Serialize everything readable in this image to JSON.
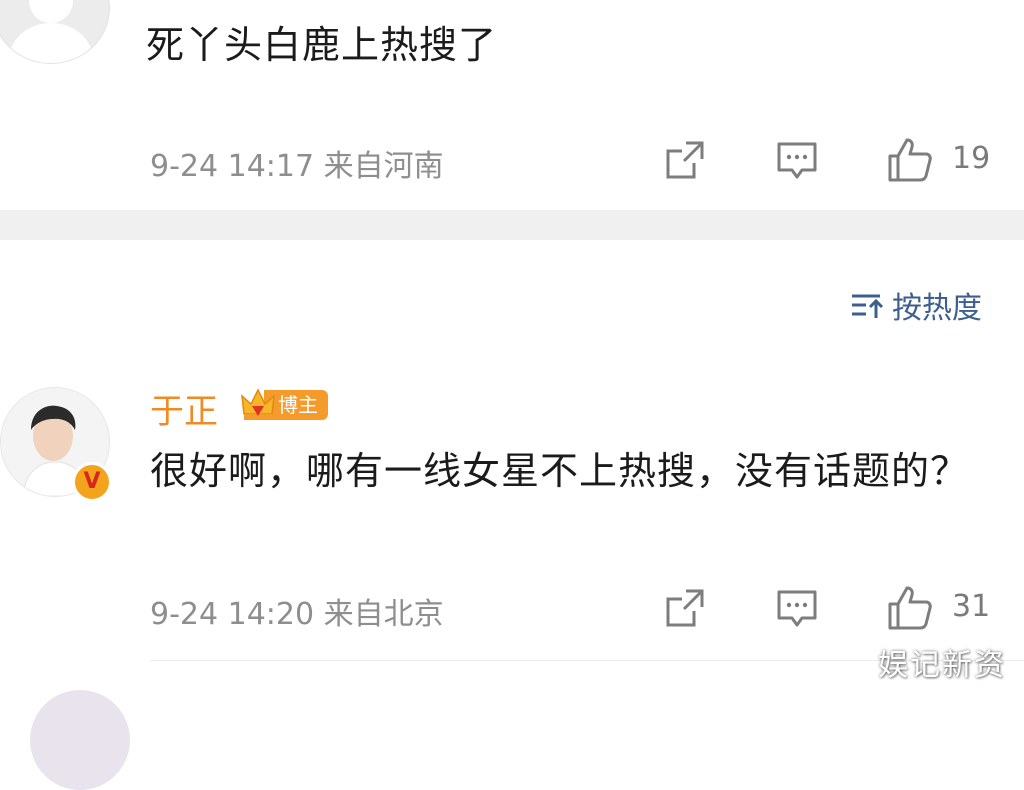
{
  "comments": [
    {
      "text": "死丫头白鹿上热搜了",
      "time": "9-24 14:17",
      "location": "来自河南",
      "like_count": "19"
    },
    {
      "username": "于正",
      "tag": "博主",
      "text": "很好啊，哪有一线女星不上热搜，没有话题的？",
      "time": "9-24 14:20",
      "location": "来自北京",
      "like_count": "31"
    }
  ],
  "sort": {
    "label": "按热度"
  },
  "verified_badge": "V",
  "watermark": "娱记新资",
  "colors": {
    "username": "#f08a24",
    "tag_bg": "#f59b2b",
    "sort_link": "#3d5f8f",
    "meta_text": "#8e8e8e",
    "verified_badge": "#f4a41c"
  },
  "icons": {
    "share": "share-icon",
    "comment": "comment-icon",
    "like": "like-icon",
    "sort": "sort-icon",
    "crown": "crown-icon"
  }
}
